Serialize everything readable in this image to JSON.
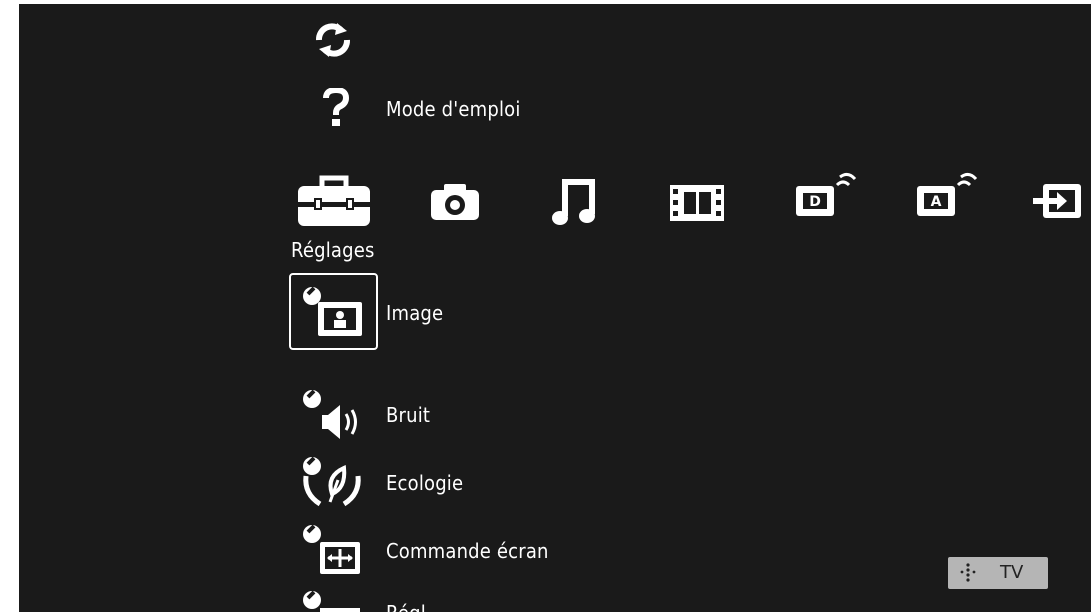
{
  "top_menu": {
    "refresh_icon": "refresh-arrows",
    "help_icon": "question-mark",
    "help_label": "Mode d'emploi"
  },
  "category_bar": {
    "selected_label": "Réglages",
    "items": [
      {
        "id": "settings",
        "icon": "toolbox",
        "selected": true
      },
      {
        "id": "photo",
        "icon": "camera"
      },
      {
        "id": "music",
        "icon": "music-note"
      },
      {
        "id": "video",
        "icon": "film-strip"
      },
      {
        "id": "digital",
        "icon": "digital-tv"
      },
      {
        "id": "analog",
        "icon": "analog-tv"
      },
      {
        "id": "input",
        "icon": "input"
      }
    ]
  },
  "settings_list": {
    "items": [
      {
        "label": "Image",
        "icon": "picture-settings",
        "focused": true
      },
      {
        "label": "Bruit",
        "icon": "sound-settings"
      },
      {
        "label": "Ecologie",
        "icon": "eco-settings"
      },
      {
        "label": "Commande écran",
        "icon": "screen-control-settings"
      },
      {
        "label": "Régl...",
        "icon": "setup-settings",
        "partially_visible": true
      }
    ]
  },
  "status_badge": {
    "label": "TV",
    "icon": "options-dots"
  },
  "colors": {
    "background": "#1a1a1a",
    "foreground": "#ffffff",
    "badge": "#b5b5b5"
  }
}
